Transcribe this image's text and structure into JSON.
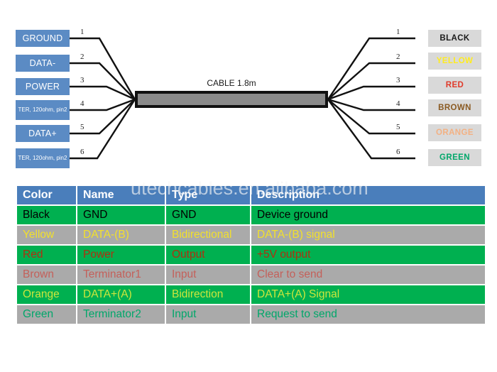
{
  "diagram": {
    "cable_label": "CABLE 1.8m",
    "left_pins": [
      {
        "label": "GROUND",
        "num": "1",
        "style": "big"
      },
      {
        "label": "DATA-",
        "num": "2",
        "style": "big"
      },
      {
        "label": "POWER",
        "num": "3",
        "style": "big"
      },
      {
        "label": "TER, 120ohm, pin2",
        "num": "4",
        "style": "small"
      },
      {
        "label": "DATA+",
        "num": "5",
        "style": "big"
      },
      {
        "label": "TER, 120ohm, pin2",
        "num": "6",
        "style": "small"
      }
    ],
    "right_pins": [
      {
        "label": "BLACK",
        "num": "1",
        "color": "#1a1a1a"
      },
      {
        "label": "YELLOW",
        "num": "2",
        "color": "#ffec1f"
      },
      {
        "label": "RED",
        "num": "3",
        "color": "#e03a2a"
      },
      {
        "label": "BROWN",
        "num": "4",
        "color": "#8a5a22"
      },
      {
        "label": "ORANGE",
        "num": "5",
        "color": "#f3b183"
      },
      {
        "label": "GREEN",
        "num": "6",
        "color": "#00a76a"
      }
    ]
  },
  "watermark": "utechcables.en.alibaba.com",
  "table": {
    "headers": [
      "Color",
      "Name",
      "Type",
      "Description"
    ],
    "rows": [
      {
        "color": "Black",
        "name": "GND",
        "type": "GND",
        "description": "Device ground",
        "bg": "green",
        "text": "#000000"
      },
      {
        "color": "Yellow",
        "name": "DATA-(B)",
        "type": "Bidirectional",
        "description": "DATA-(B) signal",
        "bg": "grey",
        "text": "#f2e02b"
      },
      {
        "color": "Red",
        "name": "Power",
        "type": "Output",
        "description": "+5V output",
        "bg": "green",
        "text": "#b03010"
      },
      {
        "color": "Brown",
        "name": "Terminator1",
        "type": "Input",
        "description": "Clear to send",
        "bg": "grey",
        "text": "#c4605a"
      },
      {
        "color": "Orange",
        "name": "DATA+(A)",
        "type": "Bidirection",
        "description": "DATA+(A) Signal",
        "bg": "green",
        "text": "#cde63c"
      },
      {
        "color": "Green",
        "name": "Terminator2",
        "type": "Input",
        "description": "Request to send",
        "bg": "grey",
        "text": "#00a76a"
      }
    ]
  },
  "colors": {
    "header_blue": "#4a7ebb",
    "pin_box_blue": "#5b8bc4",
    "row_green": "#00b050",
    "row_grey": "#aaaaaa",
    "color_box_grey": "#d9d9d9",
    "cable_grey": "#8a8a8a"
  }
}
